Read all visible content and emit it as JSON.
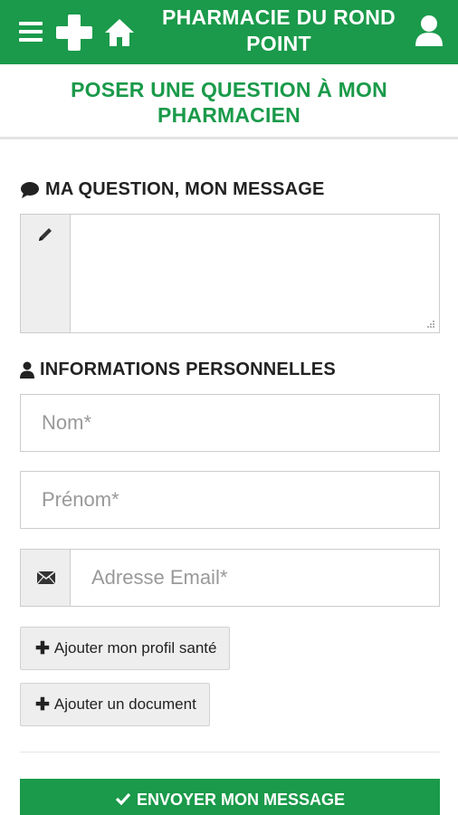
{
  "header": {
    "title": "PHARMACIE DU ROND POINT",
    "icons": [
      "menu-icon",
      "pharmacy-cross-icon",
      "home-icon",
      "user-icon"
    ]
  },
  "page": {
    "title": "POSER UNE QUESTION À MON PHARMACIEN"
  },
  "question_section": {
    "heading": "MA QUESTION, MON MESSAGE",
    "icon": "comment-icon",
    "message_value": "",
    "message_icon": "pencil-icon"
  },
  "personal_section": {
    "heading": "INFORMATIONS PERSONNELLES",
    "icon": "user-icon",
    "nom_placeholder": "Nom*",
    "nom_value": "",
    "prenom_placeholder": "Prénom*",
    "prenom_value": "",
    "email_placeholder": "Adresse Email*",
    "email_value": "",
    "email_icon": "envelope-icon"
  },
  "actions": {
    "add_health_profile": "Ajouter mon profil santé",
    "add_document": "Ajouter un document",
    "plus_glyph": "✚",
    "submit": "ENVOYER MON MESSAGE"
  },
  "colors": {
    "brand_green": "#1a9a4a",
    "addon_gray": "#eeeeee",
    "border_gray": "#cccccc"
  }
}
